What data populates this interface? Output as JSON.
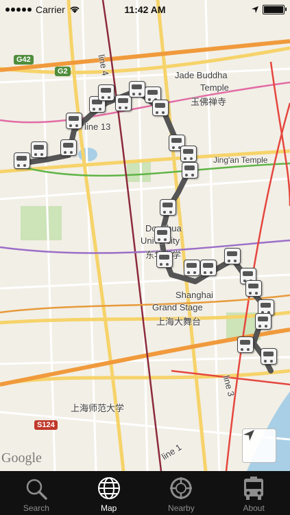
{
  "status_bar": {
    "carrier": "Carrier",
    "time": "11:42 AM"
  },
  "map": {
    "labels": {
      "line4": "line 4",
      "line13": "line 13",
      "line3": "line 3",
      "line1": "line 1",
      "jade_buddha_en1": "Jade Buddha",
      "jade_buddha_en2": "Temple",
      "jade_buddha_cn": "玉佛禅寺",
      "jingan": "Jing'an Temple",
      "donghua_en1": "Donghua",
      "donghua_en2": "University",
      "donghua_cn": "东华大学",
      "shanghai_grand_en1": "Shanghai",
      "shanghai_grand_en2": "Grand Stage",
      "shanghai_grand_cn": "上海大舞台",
      "normal_univ_cn": "上海师范大学",
      "g42": "G42",
      "g2": "G2",
      "s124": "S124"
    },
    "route_color": "#555555",
    "attribution": "Google"
  },
  "tabs": [
    {
      "label": "Search",
      "icon": "search-icon"
    },
    {
      "label": "Map",
      "icon": "globe-icon"
    },
    {
      "label": "Nearby",
      "icon": "crosshair-icon"
    },
    {
      "label": "About",
      "icon": "bus-icon"
    }
  ]
}
